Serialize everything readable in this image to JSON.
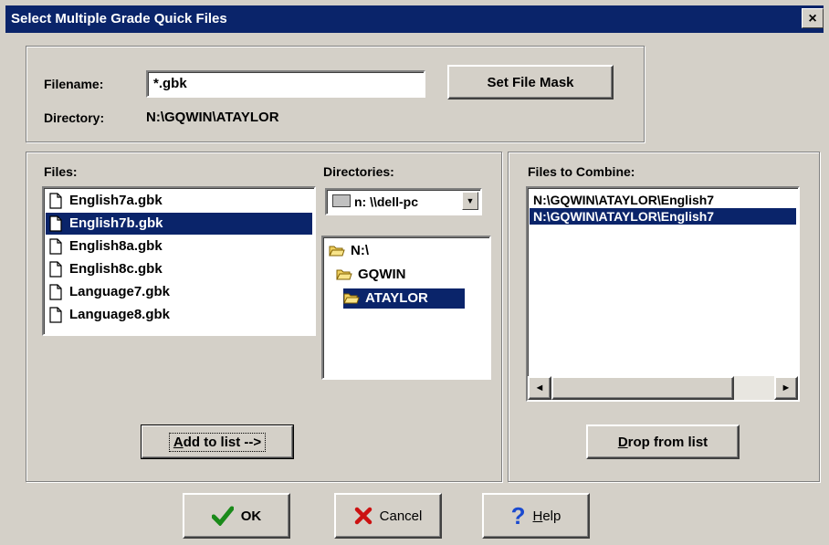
{
  "window": {
    "title": "Select Multiple Grade Quick Files",
    "close": "×"
  },
  "filename": {
    "label": "Filename:",
    "value": "*.gbk"
  },
  "set_mask": {
    "label": "Set File Mask"
  },
  "directory": {
    "label": "Directory:",
    "value": "N:\\GQWIN\\ATAYLOR"
  },
  "files": {
    "label": "Files:",
    "items": [
      {
        "name": "English7a.gbk",
        "selected": false
      },
      {
        "name": "English7b.gbk",
        "selected": true
      },
      {
        "name": "English8a.gbk",
        "selected": false
      },
      {
        "name": "English8c.gbk",
        "selected": false
      },
      {
        "name": "Language7.gbk",
        "selected": false
      },
      {
        "name": "Language8.gbk",
        "selected": false
      }
    ]
  },
  "directories": {
    "label": "Directories:",
    "drive": "n: \\\\dell-pc",
    "items": [
      {
        "name": "N:\\",
        "selected": false
      },
      {
        "name": "GQWIN",
        "selected": false
      },
      {
        "name": "ATAYLOR",
        "selected": true
      }
    ]
  },
  "add_to_list": {
    "label_u": "A",
    "label_rest": "dd to list -->"
  },
  "combine": {
    "label": "Files to Combine:",
    "items": [
      {
        "name": "N:\\GQWIN\\ATAYLOR\\English7",
        "selected": false
      },
      {
        "name": "N:\\GQWIN\\ATAYLOR\\English7",
        "selected": true
      }
    ],
    "scroll_left": "◄",
    "scroll_right": "►"
  },
  "drop_from_list": {
    "label_u": "D",
    "label_rest": "rop from list"
  },
  "ok": {
    "label": "OK",
    "icon_color": "#1a8a1a"
  },
  "cancel": {
    "label": "Cancel",
    "icon_color": "#cc1111"
  },
  "help": {
    "label_u": "H",
    "label_rest": "elp",
    "icon_color": "#1a4ad0"
  }
}
